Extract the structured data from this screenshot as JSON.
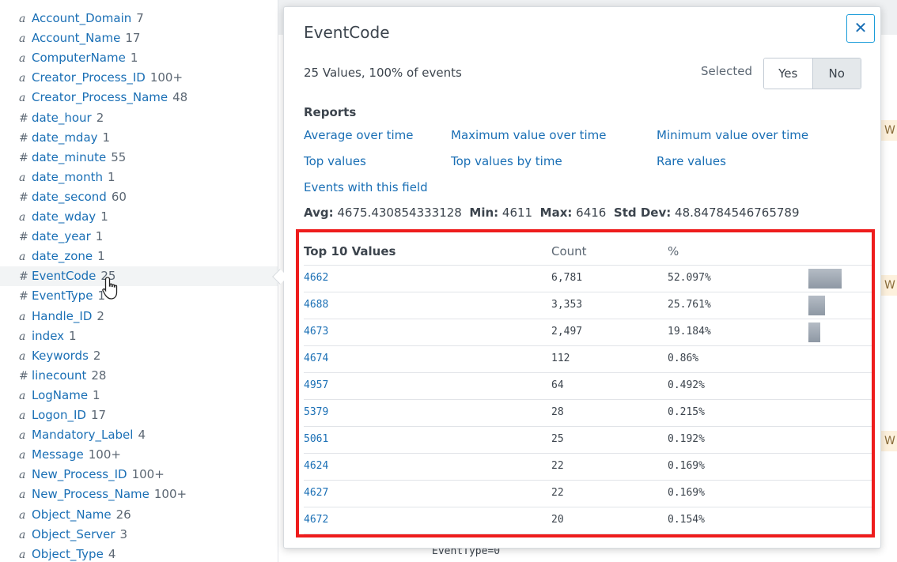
{
  "fields": [
    {
      "type": "a",
      "name": "Account_Domain",
      "count": "7"
    },
    {
      "type": "a",
      "name": "Account_Name",
      "count": "17"
    },
    {
      "type": "a",
      "name": "ComputerName",
      "count": "1"
    },
    {
      "type": "a",
      "name": "Creator_Process_ID",
      "count": "100+"
    },
    {
      "type": "a",
      "name": "Creator_Process_Name",
      "count": "48"
    },
    {
      "type": "#",
      "name": "date_hour",
      "count": "2"
    },
    {
      "type": "#",
      "name": "date_mday",
      "count": "1"
    },
    {
      "type": "#",
      "name": "date_minute",
      "count": "55"
    },
    {
      "type": "a",
      "name": "date_month",
      "count": "1"
    },
    {
      "type": "#",
      "name": "date_second",
      "count": "60"
    },
    {
      "type": "a",
      "name": "date_wday",
      "count": "1"
    },
    {
      "type": "#",
      "name": "date_year",
      "count": "1"
    },
    {
      "type": "a",
      "name": "date_zone",
      "count": "1"
    },
    {
      "type": "#",
      "name": "EventCode",
      "count": "25"
    },
    {
      "type": "#",
      "name": "EventType",
      "count": "1"
    },
    {
      "type": "a",
      "name": "Handle_ID",
      "count": "2"
    },
    {
      "type": "a",
      "name": "index",
      "count": "1"
    },
    {
      "type": "a",
      "name": "Keywords",
      "count": "2"
    },
    {
      "type": "#",
      "name": "linecount",
      "count": "28"
    },
    {
      "type": "a",
      "name": "LogName",
      "count": "1"
    },
    {
      "type": "a",
      "name": "Logon_ID",
      "count": "17"
    },
    {
      "type": "a",
      "name": "Mandatory_Label",
      "count": "4"
    },
    {
      "type": "a",
      "name": "Message",
      "count": "100+"
    },
    {
      "type": "a",
      "name": "New_Process_ID",
      "count": "100+"
    },
    {
      "type": "a",
      "name": "New_Process_Name",
      "count": "100+"
    },
    {
      "type": "a",
      "name": "Object_Name",
      "count": "26"
    },
    {
      "type": "a",
      "name": "Object_Server",
      "count": "3"
    },
    {
      "type": "a",
      "name": "Object_Type",
      "count": "4"
    }
  ],
  "active_field": "EventCode",
  "background": {
    "tag_letter": "W",
    "event_text": "EventType=0"
  },
  "popover": {
    "title": "EventCode",
    "close_label": "✕",
    "summary": "25 Values, 100% of events",
    "selected_label": "Selected",
    "toggle": {
      "yes": "Yes",
      "no": "No",
      "selected": "No"
    },
    "reports_label": "Reports",
    "reports": [
      "Average over time",
      "Maximum value over time",
      "Minimum value over time",
      "Top values",
      "Top values by time",
      "Rare values",
      "Events with this field"
    ],
    "stats": {
      "avg_label": "Avg:",
      "avg": "4675.430854333128",
      "min_label": "Min:",
      "min": "4611",
      "max_label": "Max:",
      "max": "6416",
      "std_label": "Std Dev:",
      "std": "48.84784546765789"
    },
    "table": {
      "headers": [
        "Top 10 Values",
        "Count",
        "%"
      ],
      "rows": [
        {
          "value": "4662",
          "count": "6,781",
          "pct": "52.097%",
          "fraction": 0.52097
        },
        {
          "value": "4688",
          "count": "3,353",
          "pct": "25.761%",
          "fraction": 0.25761
        },
        {
          "value": "4673",
          "count": "2,497",
          "pct": "19.184%",
          "fraction": 0.19184
        },
        {
          "value": "4674",
          "count": "112",
          "pct": "0.86%",
          "fraction": 0.0086
        },
        {
          "value": "4957",
          "count": "64",
          "pct": "0.492%",
          "fraction": 0.00492
        },
        {
          "value": "5379",
          "count": "28",
          "pct": "0.215%",
          "fraction": 0.00215
        },
        {
          "value": "5061",
          "count": "25",
          "pct": "0.192%",
          "fraction": 0.00192
        },
        {
          "value": "4624",
          "count": "22",
          "pct": "0.169%",
          "fraction": 0.00169
        },
        {
          "value": "4627",
          "count": "22",
          "pct": "0.169%",
          "fraction": 0.00169
        },
        {
          "value": "4672",
          "count": "20",
          "pct": "0.154%",
          "fraction": 0.00154
        }
      ]
    }
  },
  "colors": {
    "link": "#1a6fb5",
    "highlight": "#ee1c1c",
    "bar": "#8e98a4"
  }
}
